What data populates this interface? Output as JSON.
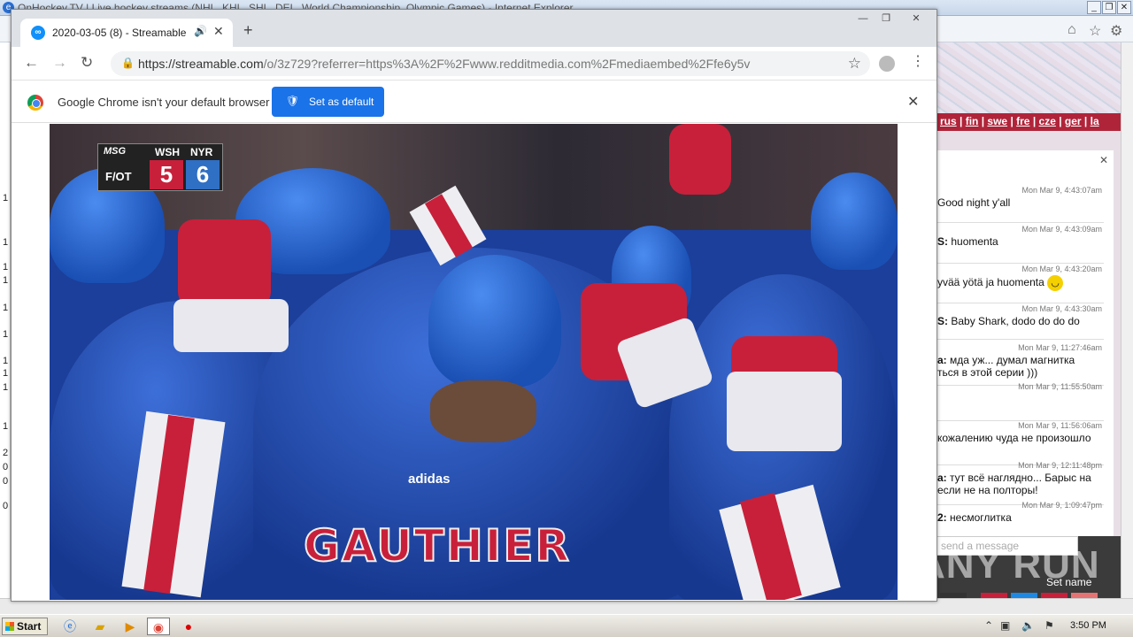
{
  "ie": {
    "title": "OnHockey.TV | Live hockey streams (NHL, KHL, SHL, DEL, World Championship, Olympic Games) - Internet Explorer",
    "lang_links": [
      "rus",
      "fin",
      "swe",
      "fre",
      "cze",
      "ger",
      "la"
    ],
    "left_strip_digits": [
      "1",
      "1",
      "1",
      "1",
      "1",
      "1",
      "1",
      "1",
      "1",
      "1",
      "2",
      "0",
      "0",
      "0"
    ],
    "chat": {
      "messages": [
        {
          "time": "Mon Mar 9, 4:43:07am",
          "user": "",
          "text": "Good night y'all"
        },
        {
          "time": "Mon Mar 9, 4:43:09am",
          "user": "S:",
          "text": "huomenta"
        },
        {
          "time": "Mon Mar 9, 4:43:20am",
          "user": "",
          "text": "yvää yötä ja huomenta"
        },
        {
          "time": "Mon Mar 9, 4:43:30am",
          "user": "S:",
          "text": "Baby Shark, dodo do do do"
        },
        {
          "time": "Mon Mar 9, 11:27:46am",
          "user": "a:",
          "text": "мда уж... думал магнитка"
        },
        {
          "time": "",
          "user": "",
          "text": "ться в этой серии )))"
        },
        {
          "time": "Mon Mar 9, 11:55:50am",
          "user": "",
          "text": ""
        },
        {
          "time": "Mon Mar 9, 11:56:06am",
          "user": "",
          "text": "кожалению чуда не произошло"
        },
        {
          "time": "Mon Mar 9, 12:11:48pm",
          "user": "a:",
          "text": "тут всё наглядно... Барыс на"
        },
        {
          "time": "",
          "user": "",
          "text": "если не на полторы!"
        },
        {
          "time": "Mon Mar 9, 1:09:47pm",
          "user": "2:",
          "text": "несмоглитка"
        }
      ],
      "input_placeholder": "send a message",
      "set_name": "Set name"
    },
    "watermark": "ANY RUN"
  },
  "chrome": {
    "tab": {
      "title": "2020-03-05 (8) - Streamable",
      "favicon": "link-icon"
    },
    "url": {
      "host": "https://streamable.com",
      "path": "/o/3z729?referrer=https%3A%2F%2Fwww.redditmedia.com%2Fmediaembed%2Ffe6y5v"
    },
    "infobar": {
      "message": "Google Chrome isn't your default browser",
      "button": "Set as default"
    }
  },
  "video": {
    "scorebug": {
      "network": "MSG",
      "period": "F/OT",
      "team1": "WSH",
      "score1": "5",
      "team2": "NYR",
      "score2": "6"
    },
    "jersey_name": "GAUTHIER",
    "jersey_brand": "adidas"
  },
  "taskbar": {
    "start": "Start",
    "clock": "3:50 PM"
  },
  "colors": {
    "rangers_blue": "#1a4fb3",
    "rangers_red": "#c8203a",
    "chrome_blue": "#1a73e8"
  }
}
